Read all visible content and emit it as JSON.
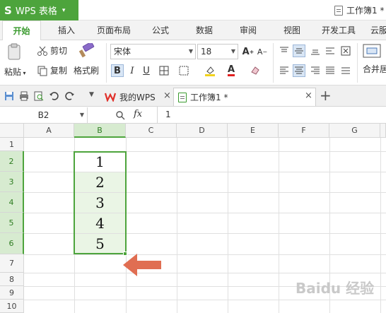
{
  "app": {
    "logo": "S",
    "name": "WPS 表格",
    "menu_caret": "▾"
  },
  "window": {
    "doc_title": "工作簿1 *"
  },
  "ribbon_tabs": [
    "开始",
    "插入",
    "页面布局",
    "公式",
    "数据",
    "审阅",
    "视图",
    "开发工具",
    "云服"
  ],
  "ribbon": {
    "paste": "粘贴",
    "cut": "剪切",
    "copy": "复制",
    "format_painter": "格式刷",
    "font_name": "宋体",
    "font_size": "18",
    "bold": "B",
    "italic": "I",
    "underline": "U",
    "merge_center": "合并居"
  },
  "quick": {
    "tabs": [
      {
        "label": "我的WPS",
        "active": false
      },
      {
        "label": "工作簿1 *",
        "active": true
      }
    ],
    "new_tab": "+"
  },
  "formula_bar": {
    "cell_ref": "B2",
    "fx": "fx",
    "value": "1"
  },
  "sheet": {
    "columns": [
      "A",
      "B",
      "C",
      "D",
      "E",
      "F",
      "G"
    ],
    "selected_column": "B",
    "rows": [
      "1",
      "2",
      "3",
      "4",
      "5",
      "6",
      "7",
      "8",
      "9",
      "10"
    ],
    "selected_rows": [
      "2",
      "3",
      "4",
      "5",
      "6"
    ],
    "b_values": [
      "1",
      "2",
      "3",
      "4",
      "5"
    ]
  },
  "watermark": "Baidu 经验",
  "colors": {
    "accent": "#4da43c",
    "arrow": "#e06e52",
    "selection_fill": "#eaf5e5"
  }
}
